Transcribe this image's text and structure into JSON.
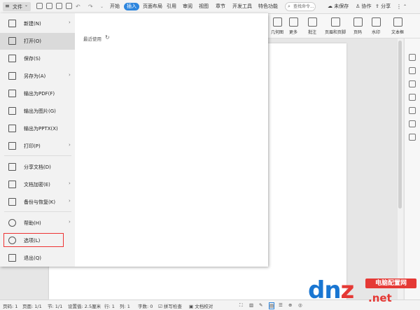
{
  "topbar": {
    "file_label": "文件",
    "tabs": [
      "开始",
      "插入",
      "页面布局",
      "引用",
      "审阅",
      "视图",
      "章节",
      "开发工具",
      "特色功能"
    ],
    "search_placeholder": "查找命令...",
    "unsaved": "未保存",
    "collab": "协作",
    "share": "分享"
  },
  "ribbon": {
    "items": [
      "几何图",
      "更多",
      "批注",
      "页眉和页脚",
      "页码",
      "水印",
      "文本框"
    ]
  },
  "menu": {
    "items": [
      {
        "label": "新建(N)",
        "icon": "new-doc-icon",
        "arrow": "›"
      },
      {
        "label": "打开(O)",
        "icon": "folder-open-icon",
        "arrow": ""
      },
      {
        "label": "保存(S)",
        "icon": "save-icon",
        "arrow": ""
      },
      {
        "label": "另存为(A)",
        "icon": "save-as-icon",
        "arrow": "›"
      },
      {
        "label": "输出为PDF(F)",
        "icon": "export-pdf-icon",
        "arrow": ""
      },
      {
        "label": "输出为图片(G)",
        "icon": "export-image-icon",
        "arrow": ""
      },
      {
        "label": "输出为PPTX(X)",
        "icon": "export-pptx-icon",
        "arrow": ""
      },
      {
        "label": "打印(P)",
        "icon": "print-icon",
        "arrow": "›"
      },
      {
        "label": "分享文档(D)",
        "icon": "share-doc-icon",
        "arrow": ""
      },
      {
        "label": "文档加密(E)",
        "icon": "encrypt-icon",
        "arrow": "›"
      },
      {
        "label": "备份与恢复(K)",
        "icon": "backup-icon",
        "arrow": "›"
      },
      {
        "label": "帮助(H)",
        "icon": "help-icon",
        "arrow": "›"
      },
      {
        "label": "选项(L)",
        "icon": "settings-gear-icon",
        "arrow": ""
      },
      {
        "label": "退出(Q)",
        "icon": "exit-icon",
        "arrow": ""
      }
    ],
    "recent_label": "最近使用"
  },
  "statusbar": {
    "page_no": "页码: 1",
    "pages": "页面: 1/1",
    "section": "节: 1/1",
    "position": "设置值: 2.5厘米",
    "row": "行: 1",
    "col": "列: 1",
    "words": "字数: 0",
    "spellcheck": "拼写检查",
    "proofread": "文档校对"
  },
  "watermark": {
    "logo": "dn",
    "logo_z": "z",
    "logo_tail": "",
    "site_cn": "电脑配置网",
    "site_net": ".net"
  },
  "colors": {
    "accent": "#2e86de",
    "highlight": "#e33333"
  }
}
